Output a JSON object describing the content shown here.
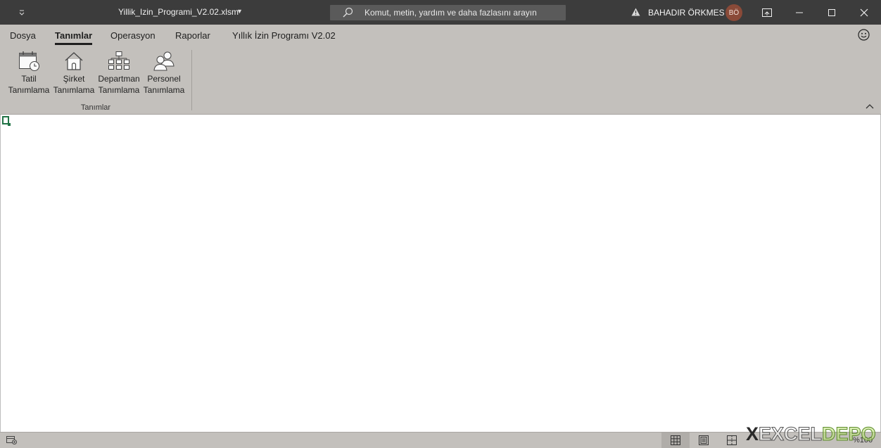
{
  "titlebar": {
    "filename": "Yillik_Izin_Programi_V2.02.xlsm",
    "search_placeholder": "Komut, metin, yardım ve daha fazlasını arayın",
    "user_name": "BAHADIR ÖRKMES",
    "user_initials": "BÖ"
  },
  "ribbon": {
    "tabs": [
      {
        "label": "Dosya",
        "active": false
      },
      {
        "label": "Tanımlar",
        "active": true
      },
      {
        "label": "Operasyon",
        "active": false
      },
      {
        "label": "Raporlar",
        "active": false
      },
      {
        "label": "Yıllık İzin Programı V2.02",
        "active": false
      }
    ],
    "group": {
      "label": "Tanımlar",
      "buttons": [
        {
          "line1": "Tatil",
          "line2": "Tanımlama",
          "icon": "calendar-clock-icon"
        },
        {
          "line1": "Şirket",
          "line2": "Tanımlama",
          "icon": "house-icon"
        },
        {
          "line1": "Departman",
          "line2": "Tanımlama",
          "icon": "org-chart-icon"
        },
        {
          "line1": "Personel",
          "line2": "Tanımlama",
          "icon": "people-icon"
        }
      ]
    }
  },
  "statusbar": {
    "zoom_label": "%100"
  },
  "watermark": {
    "x": "X",
    "excel": "EXCEL",
    "depo": "DEPO"
  },
  "colors": {
    "titlebar_bg": "#3c3c3c",
    "ribbon_bg": "#c3c0bc",
    "accent_green": "#217346",
    "avatar_bg": "#8a4a38"
  }
}
